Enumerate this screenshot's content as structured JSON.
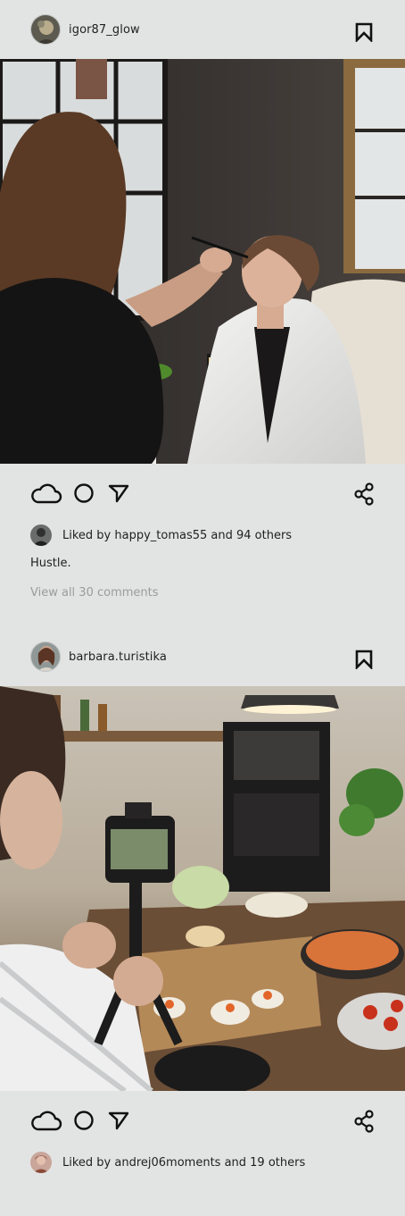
{
  "posts": [
    {
      "username": "igor87_glow",
      "liked_by_text": "Liked by happy_tomas55 and 94 others",
      "caption": "Hustle.",
      "comments_link": "View all 30 comments"
    },
    {
      "username": "barbara.turistika",
      "liked_by_text": "Liked by andrej06moments and 19 others"
    }
  ],
  "icons": {
    "like": "cloud-icon",
    "comment": "circle-icon",
    "send": "send-icon",
    "share": "share-icon",
    "save": "bookmark-icon"
  },
  "colors": {
    "background": "#e2e4e3",
    "text": "#1f1f1f",
    "muted": "#9a9c9b"
  }
}
